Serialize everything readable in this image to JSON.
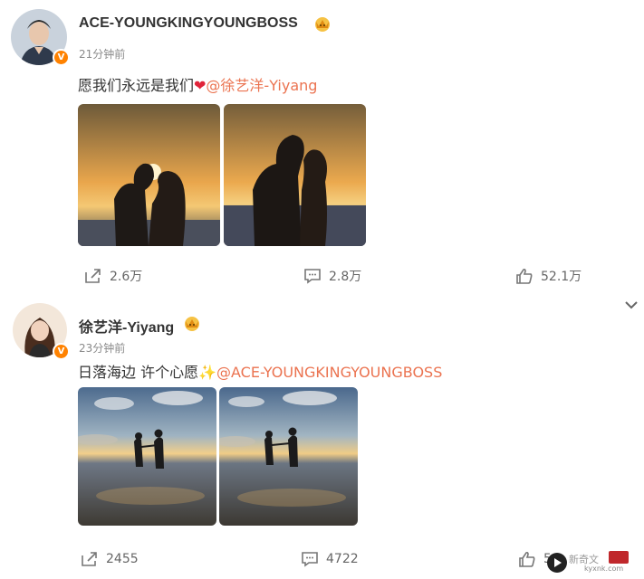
{
  "posts": [
    {
      "author": "ACE-YOUNGKINGYOUNGBOSS",
      "time": "21分钟前",
      "text": "愿我们永远是我们",
      "emoji": "heart",
      "mention": "@徐艺洋-Yiyang",
      "verified_badge": "V",
      "images": [
        "sunset-couple-kiss-silhouette-1",
        "sunset-couple-kiss-silhouette-2"
      ],
      "actions": {
        "share": "2.6万",
        "comment": "2.8万",
        "like": "52.1万"
      }
    },
    {
      "author": "徐艺洋-Yiyang",
      "time": "23分钟前",
      "text": "日落海边 许个心愿",
      "emoji": "sparkles",
      "mention": "@ACE-YOUNGKINGYOUNGBOSS",
      "verified_badge": "V",
      "images": [
        "beach-couple-holding-hands-1",
        "beach-couple-holding-hands-2"
      ],
      "actions": {
        "share": "2455",
        "comment": "4722",
        "like": "5"
      }
    }
  ],
  "icons": {
    "share": "share-icon",
    "comment": "comment-icon",
    "like": "thumbs-up-icon",
    "expand": "chevron-down-icon",
    "membership": "crown-icon"
  },
  "overlay": {
    "watermark_text": "新奇文",
    "watermark_url": "kyxnk.com"
  },
  "colors": {
    "mention": "#eb7350",
    "verified": "#ff8200",
    "time": "#8a8a8a"
  }
}
